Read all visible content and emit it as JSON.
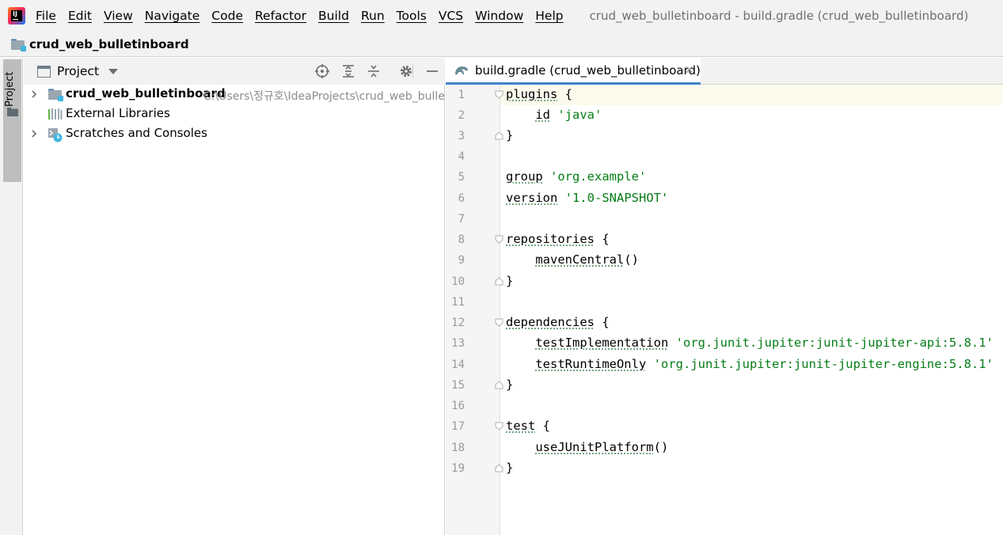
{
  "menubar": {
    "items": [
      "File",
      "Edit",
      "View",
      "Navigate",
      "Code",
      "Refactor",
      "Build",
      "Run",
      "Tools",
      "VCS",
      "Window",
      "Help"
    ],
    "window_title": "crud_web_bulletinboard - build.gradle (crud_web_bulletinboard)"
  },
  "navbar": {
    "breadcrumb": "crud_web_bulletinboard"
  },
  "stripe": {
    "project_label": "Project"
  },
  "project_panel": {
    "title": "Project",
    "tree": [
      {
        "label": "crud_web_bulletinboard",
        "path": "C:\\Users\\정규호\\IdeaProjects\\crud_web_bulletinboard"
      },
      {
        "label": "External Libraries"
      },
      {
        "label": "Scratches and Consoles"
      }
    ]
  },
  "editor": {
    "tab_label": "build.gradle (crud_web_bulletinboard)",
    "line_numbers": [
      "1",
      "2",
      "3",
      "4",
      "5",
      "6",
      "7",
      "8",
      "9",
      "10",
      "11",
      "12",
      "13",
      "14",
      "15",
      "16",
      "17",
      "18",
      "19"
    ],
    "code": {
      "l1_kw": "plugins",
      "l1_rest": " {",
      "l2_kw": "id",
      "l2_str": "'java'",
      "l3": "}",
      "l5_kw": "group",
      "l5_str": "'org.example'",
      "l6_kw": "version",
      "l6_str": "'1.0-SNAPSHOT'",
      "l8_kw": "repositories",
      "l8_rest": " {",
      "l9_kw": "mavenCentral",
      "l9_rest": "()",
      "l10": "}",
      "l12_kw": "dependencies",
      "l12_rest": " {",
      "l13_kw": "testImplementation",
      "l13_str": "'org.junit.jupiter:junit-jupiter-api:5.8.1'",
      "l14_kw": "testRuntimeOnly",
      "l14_str": "'org.junit.jupiter:junit-jupiter-engine:5.8.1'",
      "l15": "}",
      "l17_kw": "test",
      "l17_rest": " {",
      "l18_kw": "useJUnitPlatform",
      "l18_rest": "()",
      "l19": "}"
    }
  },
  "colors": {
    "string": "#067d17",
    "line_numbers": "#999999",
    "tab_underline": "#4083c9",
    "current_line": "#fcfaed"
  }
}
